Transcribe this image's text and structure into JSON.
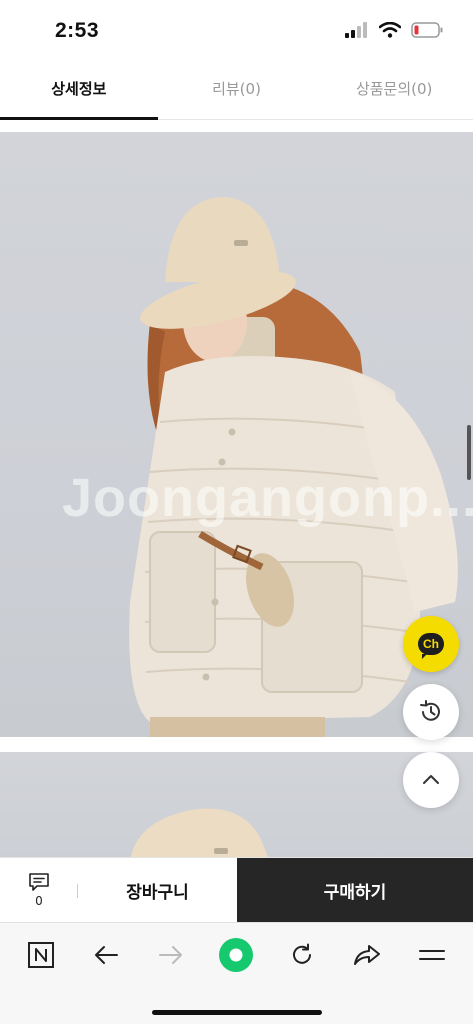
{
  "status_bar": {
    "time": "2:53"
  },
  "tabs": [
    {
      "label": "상세정보",
      "active": true
    },
    {
      "label": "리뷰(0)",
      "active": false
    },
    {
      "label": "상품문의(0)",
      "active": false
    }
  ],
  "product": {
    "watermark": "Joongangonp..."
  },
  "floating": {
    "channel_label": "Ch"
  },
  "purchase_bar": {
    "inquiry_count": "0",
    "cart_label": "장바구니",
    "buy_label": "구매하기"
  },
  "colors": {
    "channel_yellow": "#f5dc00",
    "buy_button_bg": "#262626",
    "nav_green": "#16c96f"
  },
  "browser_toolbar": {
    "icons": [
      "naver-n-icon",
      "back-arrow-icon",
      "forward-arrow-icon",
      "green-dot-icon",
      "refresh-icon",
      "share-icon",
      "menu-icon"
    ]
  }
}
